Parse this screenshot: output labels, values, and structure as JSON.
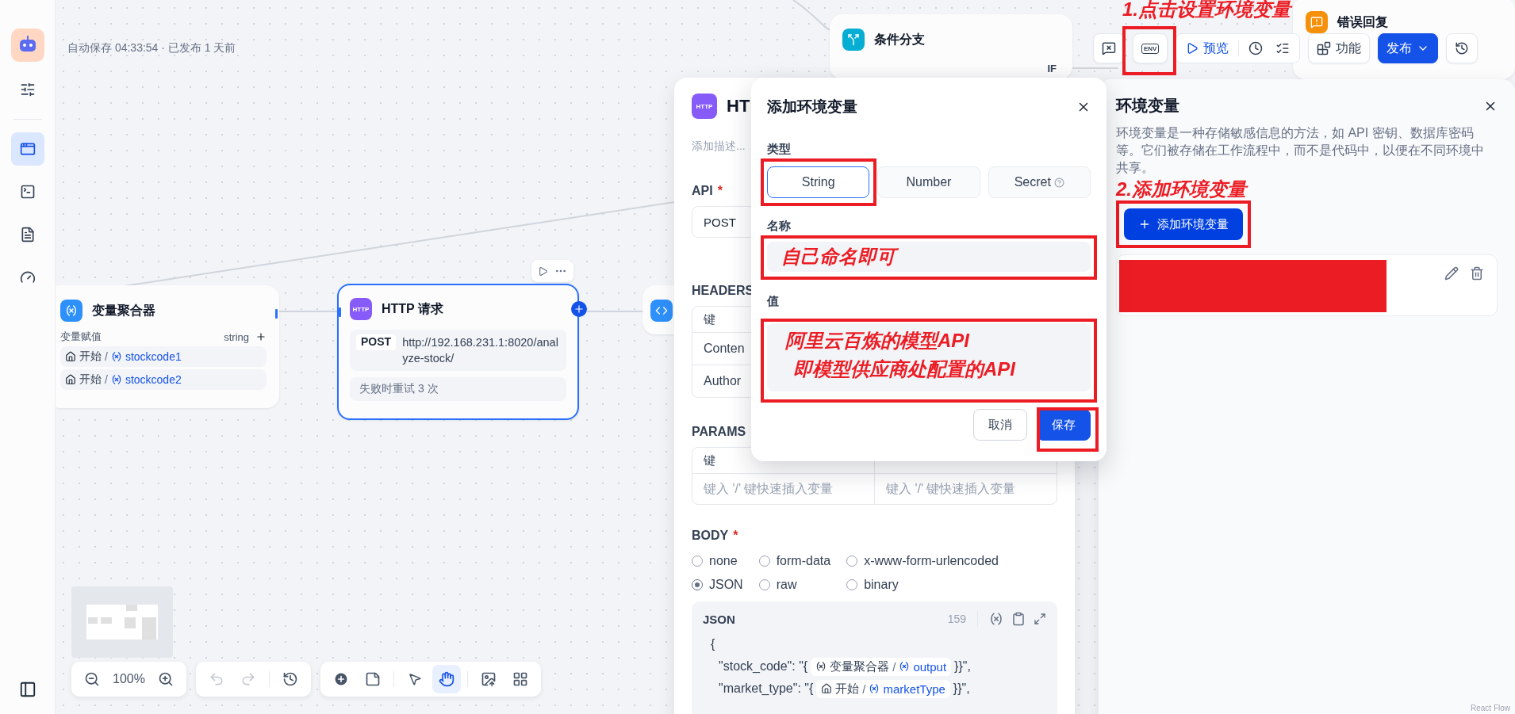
{
  "sidebar": {
    "items": [
      {
        "kind": "tune",
        "selected": false
      },
      {
        "kind": "workflow",
        "selected": true
      },
      {
        "kind": "terminal",
        "selected": false
      },
      {
        "kind": "log",
        "selected": false
      },
      {
        "kind": "gauge",
        "selected": false
      }
    ]
  },
  "canvas": {
    "status": "自动保存 04:33:54 · 已发布 1 天前",
    "condition_node": {
      "title": "条件分支",
      "branch": "IF"
    },
    "error_node": {
      "title": "错误回复"
    },
    "aggregator_node": {
      "title": "变量聚合器",
      "label": "变量赋值",
      "type": "string",
      "vars": [
        {
          "source": "开始",
          "separator": "/",
          "name": "stockcode1"
        },
        {
          "source": "开始",
          "separator": "/",
          "name": "stockcode2"
        }
      ]
    },
    "http_node": {
      "badge": "HTTP",
      "title": "HTTP 请求",
      "method": "POST",
      "url": "http://192.168.231.1:8020/analyze-stock/",
      "retry": "失败时重试 3 次",
      "selected": true
    },
    "zoom": "100%",
    "history": [
      {
        "kind": "undo",
        "disabled": true
      },
      {
        "kind": "redo",
        "disabled": true
      },
      {
        "kind": "history",
        "disabled": false
      }
    ],
    "tools": [
      {
        "kind": "add",
        "selected": false
      },
      {
        "kind": "note",
        "selected": false
      },
      {
        "kind": "pointer",
        "selected": false
      },
      {
        "kind": "hand",
        "selected": true
      },
      {
        "kind": "export",
        "selected": false
      },
      {
        "kind": "organize",
        "selected": false
      }
    ],
    "attribution": "React Flow"
  },
  "toolbar": {
    "env": "ENV",
    "preview": "预览",
    "features": "功能",
    "publish": "发布"
  },
  "http_panel": {
    "badge": "HTTP",
    "title": "HT",
    "description_placeholder": "添加描述...",
    "api_label": "API",
    "api_mark": "*",
    "method": "POST",
    "headers_label": "HEADERS",
    "headers_column": "键",
    "headers_rows": [
      "Conten",
      "Author"
    ],
    "params_label": "PARAMS",
    "params_column": "键",
    "params_placeholders": [
      "键入 '/' 键快速插入变量",
      "键入 '/' 键快速插入变量"
    ],
    "body_label": "BODY",
    "body_mark": "*",
    "body_types": [
      {
        "label": "none",
        "selected": false
      },
      {
        "label": "form-data",
        "selected": false
      },
      {
        "label": "x-www-form-urlencoded",
        "selected": false
      },
      {
        "label": "JSON",
        "selected": true
      },
      {
        "label": "raw",
        "selected": false
      },
      {
        "label": "binary",
        "selected": false
      }
    ],
    "editor": {
      "title": "JSON",
      "count": "159",
      "lines": [
        [
          {
            "kind": "text",
            "text": "{"
          }
        ],
        [
          {
            "kind": "text",
            "text": "\"stock_code\": \"{"
          },
          {
            "kind": "aggregator_ref",
            "source": "变量聚合器",
            "separator": "/",
            "name": "output"
          },
          {
            "kind": "text",
            "text": "}}\","
          }
        ],
        [
          {
            "kind": "text",
            "text": "\"market_type\": \"{"
          },
          {
            "kind": "start_ref",
            "source": "开始",
            "separator": "/",
            "name": "marketType"
          },
          {
            "kind": "text",
            "text": "}}\","
          }
        ]
      ]
    }
  },
  "dialog": {
    "title": "添加环境变量",
    "type_label": "类型",
    "types": [
      {
        "label": "String",
        "selected": true,
        "help": false
      },
      {
        "label": "Number",
        "selected": false,
        "help": false
      },
      {
        "label": "Secret",
        "selected": false,
        "help": true
      }
    ],
    "name_label": "名称",
    "value_label": "值",
    "cancel": "取消",
    "save": "保存"
  },
  "env_panel": {
    "title": "环境变量",
    "description": "环境变量是一种存储敏感信息的方法，如 API 密钥、数据库密码等。它们被存储在工作流程中，而不是代码中，以便在不同环境中共享。",
    "add_button": "添加环境变量",
    "variables": [
      {
        "kind": "redacted"
      }
    ]
  },
  "annotations": {
    "step1": "1.点击设置环境变量",
    "step2": "2.添加环境变量",
    "name_note": "自己命名即可",
    "value_note": [
      "阿里云百炼的模型API",
      "即模型供应商处配置的API"
    ]
  }
}
